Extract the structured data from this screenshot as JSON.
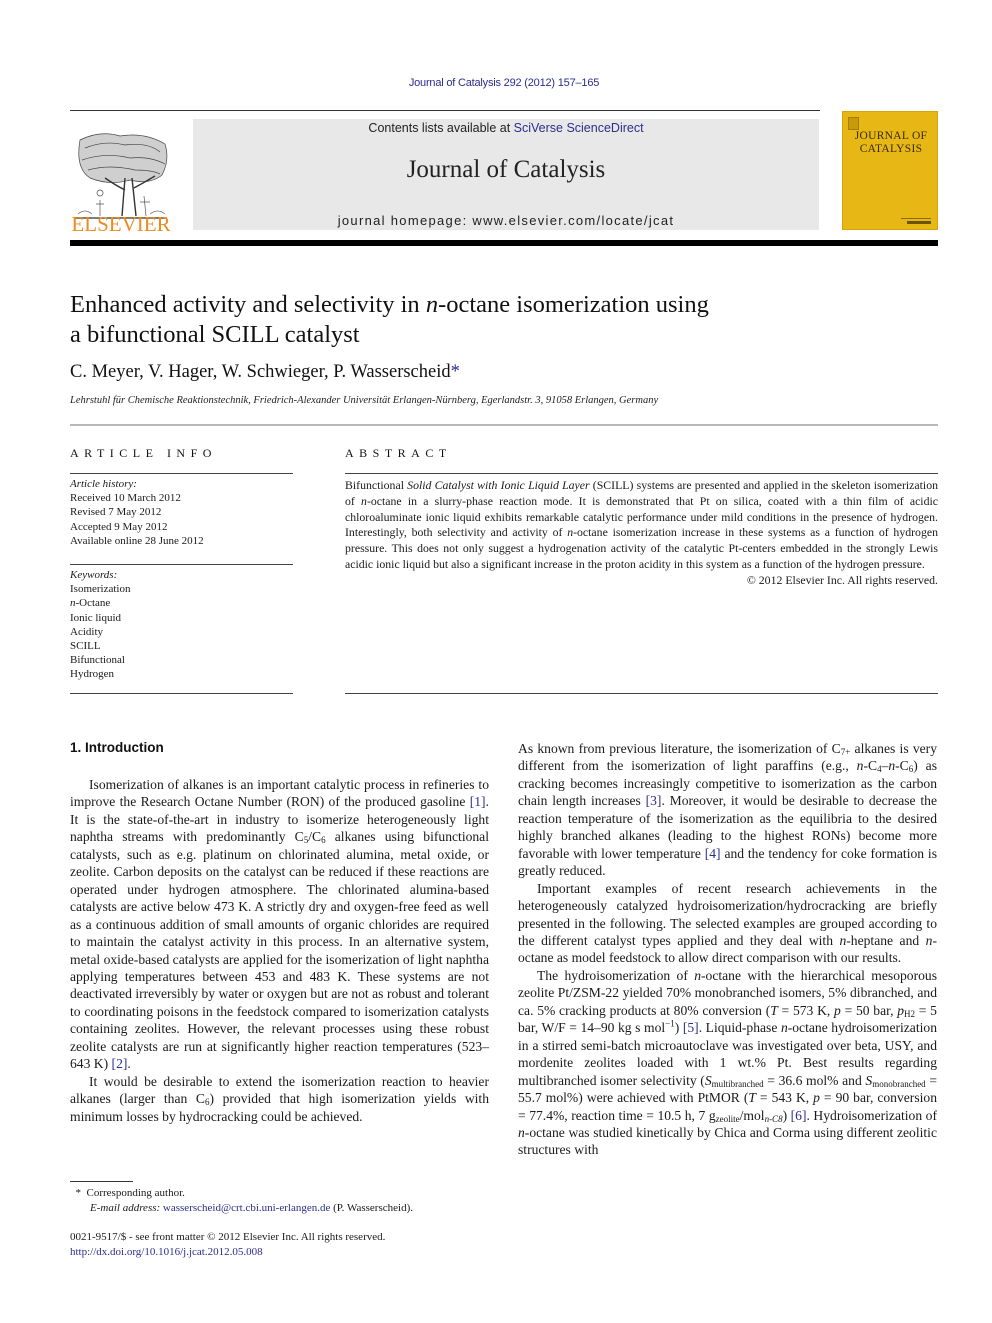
{
  "header": {
    "citation": "Journal of Catalysis 292 (2012) 157–165",
    "contents_prefix": "Contents lists available at ",
    "contents_link": "SciVerse ScienceDirect",
    "journal_name": "Journal of Catalysis",
    "homepage": "journal homepage: www.elsevier.com/locate/jcat",
    "publisher": "ELSEVIER",
    "cover_title_line1": "JOURNAL OF",
    "cover_title_line2": "CATALYSIS",
    "colors": {
      "link": "#2b2e8c",
      "elsevier_orange": "#f08a1c",
      "cover_yellow": "#e7b715",
      "banner_grey": "#e8e8e8"
    }
  },
  "article": {
    "title_part1": "Enhanced activity and selectivity in ",
    "title_italic": "n",
    "title_part2": "-octane isomerization using",
    "title_line2": "a bifunctional SCILL catalyst",
    "authors": "C. Meyer, V. Hager, W. Schwieger, P. Wasserscheid",
    "corresponding_mark": "*",
    "affiliation": "Lehrstuhl für Chemische Reaktionstechnik, Friedrich-Alexander Universität Erlangen-Nürnberg, Egerlandstr. 3, 91058 Erlangen, Germany"
  },
  "article_info": {
    "heading": "ARTICLE INFO",
    "history_label": "Article history:",
    "history": [
      "Received 10 March 2012",
      "Revised 7 May 2012",
      "Accepted 9 May 2012",
      "Available online 28 June 2012"
    ],
    "keywords_label": "Keywords:",
    "keywords": [
      "Isomerization",
      "-Octane",
      "Ionic liquid",
      "Acidity",
      "SCILL",
      "Bifunctional",
      "Hydrogen"
    ],
    "keyword_italic_prefix": "n"
  },
  "abstract": {
    "heading": "ABSTRACT",
    "s1": "Bifunctional ",
    "s1_italic": "Solid Catalyst with Ionic Liquid Layer",
    "s2": " (SCILL) systems are presented and applied in the skeleton isomerization of ",
    "n": "n",
    "s3": "-octane in a slurry-phase reaction mode. It is demonstrated that Pt on silica, coated with a thin film of acidic chloroaluminate ionic liquid exhibits remarkable catalytic performance under mild conditions in the presence of hydrogen. Interestingly, both selectivity and activity of ",
    "s4": "-octane isomerization increase in these systems as a function of hydrogen pressure. This does not only suggest a hydrogenation activity of the catalytic Pt-centers embedded in the strongly Lewis acidic ionic liquid but also a significant increase in the proton acidity in this system as a function of the hydrogen pressure.",
    "copyright": "© 2012 Elsevier Inc. All rights reserved."
  },
  "intro": {
    "heading": "1. Introduction",
    "p1_a": "Isomerization of alkanes is an important catalytic process in refineries to improve the Research Octane Number (RON) of the produced gasoline ",
    "ref1": "[1]",
    "p1_b": ". It is the state-of-the-art in industry to isomerize heterogeneously light naphtha streams with predominantly C",
    "sub5": "5",
    "p1_c": "/C",
    "sub6": "6",
    "p1_d": " alkanes using bifunctional catalysts, such as e.g. platinum on chlorinated alumina, metal oxide, or zeolite. Carbon deposits on the catalyst can be reduced if these reactions are operated under hydrogen atmosphere. The chlorinated alumina-based catalysts are active below 473 K. A strictly dry and oxygen-free feed as well as a continuous addition of small amounts of organic chlorides are required to maintain the catalyst activity in this process. In an alternative system, metal oxide-based catalysts are applied for the isomerization of light naphtha applying temperatures between 453 and 483 K. These systems are not deactivated irreversibly by water or oxygen but are not as robust and tolerant to coordinating poisons in the feedstock compared to isomerization catalysts containing zeolites. However, the relevant processes using these robust zeolite catalysts are run at significantly higher reaction temperatures (523–643 K) ",
    "ref2": "[2]",
    "p1_e": ".",
    "p2_a": "It would be desirable to extend the isomerization reaction to heavier alkanes (larger than C",
    "p2_b": ") provided that high isomerization yields with minimum losses by hydrocracking could be achieved.",
    "r1_a": "As known from previous literature, the isomerization of C",
    "sub7": "7+",
    "r1_b": " alkanes is very different from the isomerization of light paraffins (e.g., ",
    "n": "n",
    "r1_c": "-C",
    "sub4": "4",
    "r1_d": "–",
    "r1_e": "-C",
    "r1_f": ") as cracking becomes increasingly competitive to isomerization as the carbon chain length increases ",
    "ref3": "[3]",
    "r1_g": ". Moreover, it would be desirable to decrease the reaction temperature of the isomerization as the equilibria to the desired highly branched alkanes (leading to the highest RONs) become more favorable with lower temperature ",
    "ref4": "[4]",
    "r1_h": " and the tendency for coke formation is greatly reduced.",
    "r2_a": "Important examples of recent research achievements in the heterogeneously catalyzed hydroisomerization/hydrocracking are briefly presented in the following. The selected examples are grouped according to the different catalyst types applied and they deal with ",
    "r2_b": "-heptane and ",
    "r2_c": "-octane as model feedstock to allow direct comparison with our results.",
    "r3_a": "The hydroisomerization of ",
    "r3_b": "-octane with the hierarchical mesoporous zeolite Pt/ZSM-22 yielded 70% monobranched isomers, 5% dibranched, and ca. 5% cracking products at 80% conversion (",
    "T": "T",
    "r3_c": " = 573 K, ",
    "p": "p",
    "r3_d": " = 50 bar, ",
    "subH2": "H2",
    "r3_e": " = 5 bar, W/F = 14–90 kg s mol",
    "supm1": "−1",
    "r3_f": ") ",
    "ref5": "[5]",
    "r3_g": ". Liquid-phase ",
    "r3_h": "-octane hydroisomerization in a stirred semi-batch microautoclave was investigated over beta, USY, and mordenite zeolites loaded with 1 wt.% Pt. Best results regarding multibranched isomer selectivity (",
    "S": "S",
    "subMulti": "multibranched",
    "r3_i": " = 36.6 mol% and ",
    "subMono": "monobranched",
    "r3_j": " = 55.7 mol%) were achieved with PtMOR (",
    "r3_k": " = 543 K, ",
    "r3_l": " = 90 bar, conversion = 77.4%, reaction time = 10.5 h, 7 g",
    "subZeo": "zeolite",
    "r3_m": "/mol",
    "subnC8": "n-C8",
    "r3_n": ") ",
    "ref6": "[6]",
    "r3_o": ". Hydroisomerization of ",
    "r3_p": "-octane was studied kinetically by Chica and Corma using different zeolitic structures with"
  },
  "footnote": {
    "mark": "*",
    "label": "Corresponding author.",
    "email_label": "E-mail address:",
    "email": "wasserscheid@crt.cbi.uni-erlangen.de",
    "email_suffix": " (P. Wasserscheid).",
    "issn": "0021-9517/$ - see front matter © 2012 Elsevier Inc. All rights reserved.",
    "doi": "http://dx.doi.org/10.1016/j.jcat.2012.05.008"
  }
}
